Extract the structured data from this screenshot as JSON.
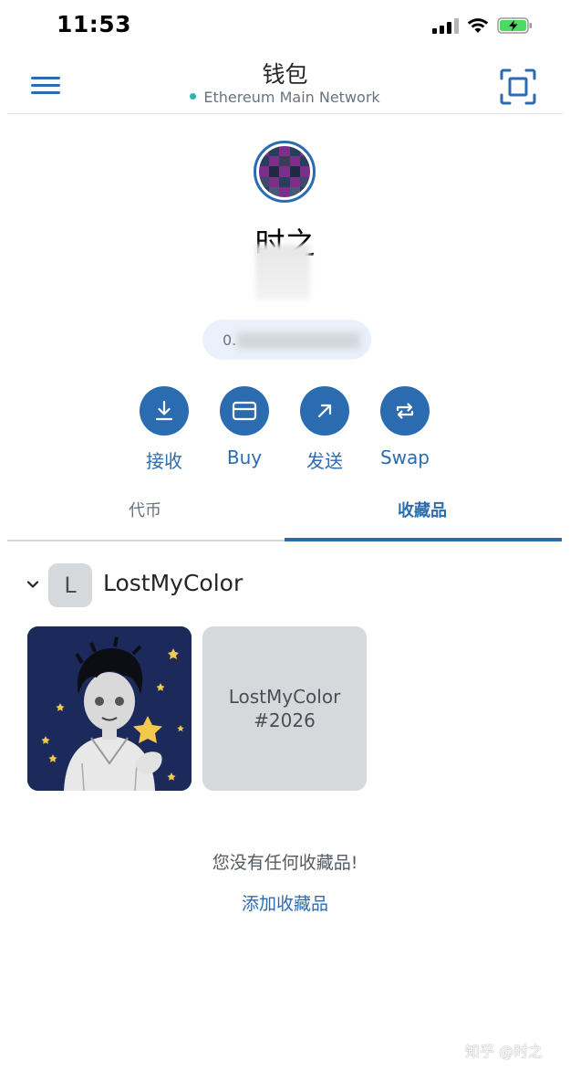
{
  "status_bar": {
    "time": "11:53"
  },
  "header": {
    "title": "钱包",
    "network": "Ethereum Main Network"
  },
  "account": {
    "name": "时之",
    "address_prefix": "0."
  },
  "actions": [
    {
      "label": "接收",
      "icon": "download-icon"
    },
    {
      "label": "Buy",
      "icon": "card-icon"
    },
    {
      "label": "发送",
      "icon": "arrow-up-right-icon"
    },
    {
      "label": "Swap",
      "icon": "swap-icon"
    }
  ],
  "tabs": {
    "tokens": "代币",
    "collectibles": "收藏品",
    "active": "collectibles"
  },
  "collection": {
    "initial": "L",
    "name": "LostMyColor",
    "items": [
      {
        "type": "artwork"
      },
      {
        "type": "placeholder",
        "title": "LostMyColor",
        "token_id": "#2026"
      }
    ]
  },
  "empty_state": {
    "message": "您没有任何收藏品!",
    "add_link": "添加收藏品"
  },
  "watermark": "知乎 @时之",
  "colors": {
    "accent": "#2b6cb0",
    "network_dot": "#29b6af",
    "placeholder_bg": "#d6d9dc"
  }
}
